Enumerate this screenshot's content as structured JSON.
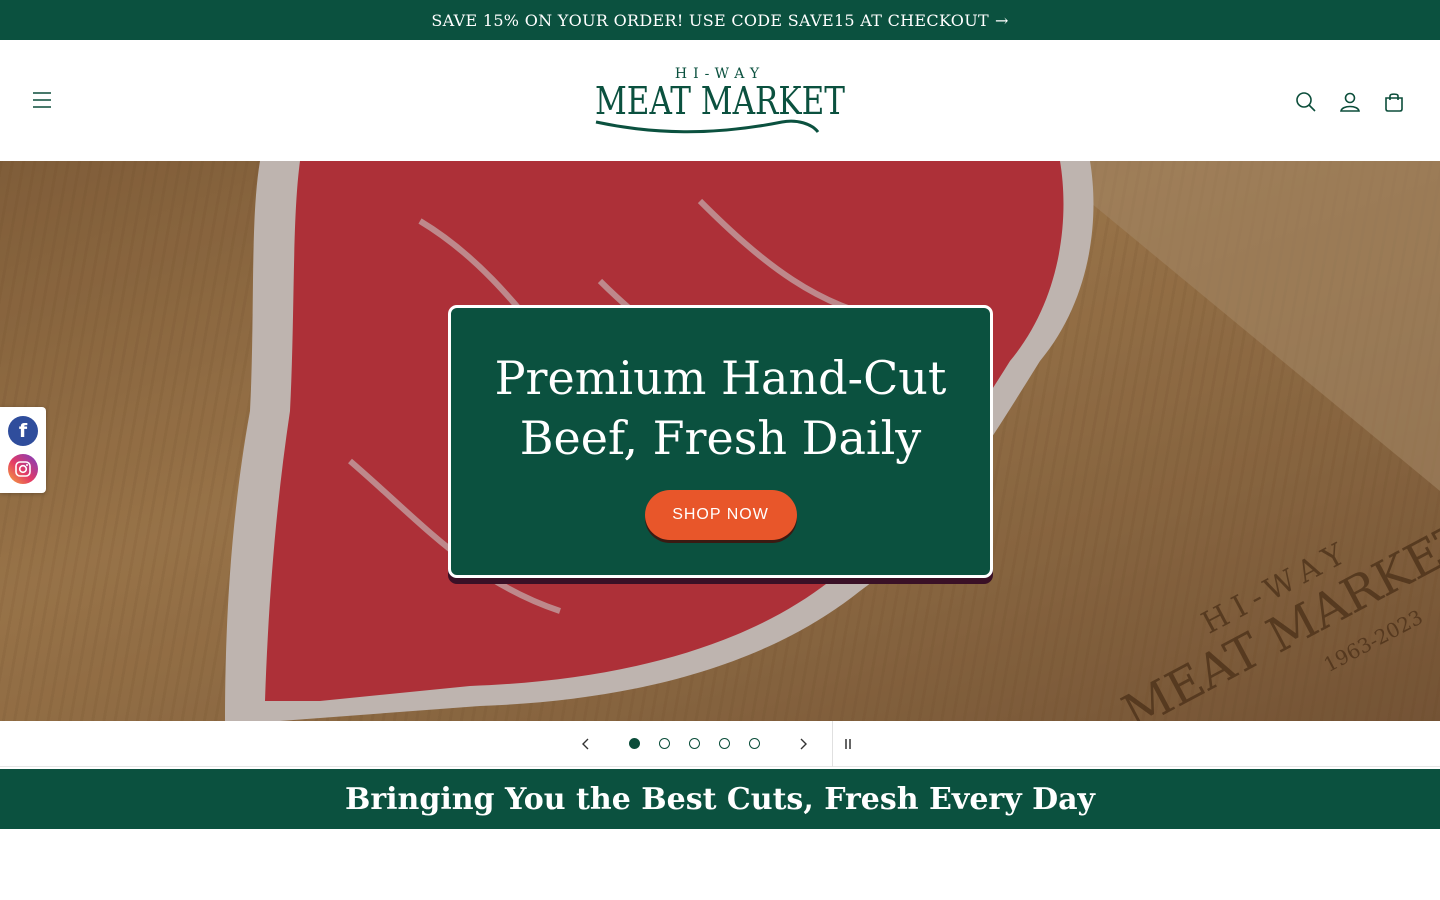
{
  "announcement": {
    "text": "SAVE 15% ON YOUR ORDER! USE CODE SAVE15 AT CHECKOUT",
    "arrow": "→"
  },
  "header": {
    "logo": {
      "top_text": "HI-WAY",
      "main_text": "MEAT MARKET"
    },
    "icons": [
      "menu-icon",
      "search-icon",
      "account-icon",
      "cart-icon"
    ]
  },
  "hero": {
    "title": "Premium Hand-Cut Beef, Fresh Daily",
    "button_label": "SHOP NOW",
    "board_brand": {
      "top": "HI-WAY",
      "main": "MEAT MARKET",
      "years": "1963-2023"
    }
  },
  "social": {
    "icons": [
      "facebook-icon",
      "instagram-icon"
    ],
    "facebook_glyph": "f"
  },
  "slider": {
    "slide_count": 5,
    "active_slide": 1
  },
  "tagline": {
    "text": "Bringing You the Best Cuts, Fresh Every Day"
  },
  "colors": {
    "brand_green": "#0b513f",
    "accent_orange": "#e8562a",
    "white": "#ffffff"
  }
}
